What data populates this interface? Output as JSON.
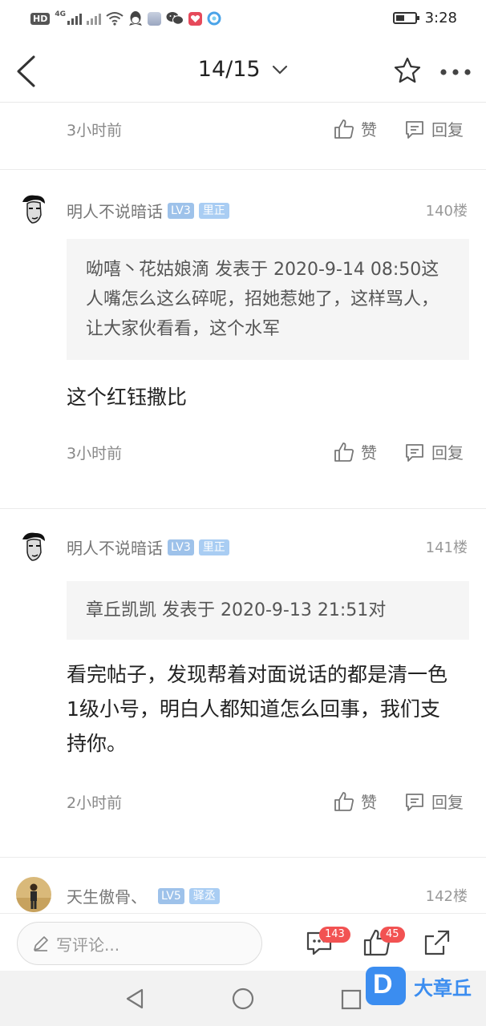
{
  "status_bar": {
    "network_label": "HD",
    "network_type": "4G",
    "time": "3:28"
  },
  "header": {
    "page_indicator": "14/15"
  },
  "posts": [
    {
      "time": "3小时前",
      "like_label": "赞",
      "reply_label": "回复"
    },
    {
      "username": "明人不说暗话",
      "level": "LV3",
      "title": "里正",
      "floor": "140楼",
      "quote": "呦嘻丶花姑娘滴 发表于 2020-9-14 08:50这人嘴怎么这么碎呢，招她惹她了，这样骂人，让大家伙看看，这个水军",
      "content": "这个红钰撒比",
      "time": "3小时前",
      "like_label": "赞",
      "reply_label": "回复"
    },
    {
      "username": "明人不说暗话",
      "level": "LV3",
      "title": "里正",
      "floor": "141楼",
      "quote": "章丘凯凯 发表于 2020-9-13 21:51对",
      "content": "看完帖子，发现帮着对面说话的都是清一色1级小号，明白人都知道怎么回事，我们支持你。",
      "time": "2小时前",
      "like_label": "赞",
      "reply_label": "回复"
    },
    {
      "username": "天生傲骨、",
      "level": "LV5",
      "title": "驿丞",
      "floor": "142楼"
    }
  ],
  "bottom_bar": {
    "comment_placeholder": "写评论...",
    "comment_count": "143",
    "like_count": "45"
  },
  "watermark": {
    "logo_letter": "D",
    "text": "大章丘"
  },
  "colors": {
    "level_badge": "#9ec2ea",
    "count_badge": "#f25252",
    "watermark": "#3b8df0"
  }
}
